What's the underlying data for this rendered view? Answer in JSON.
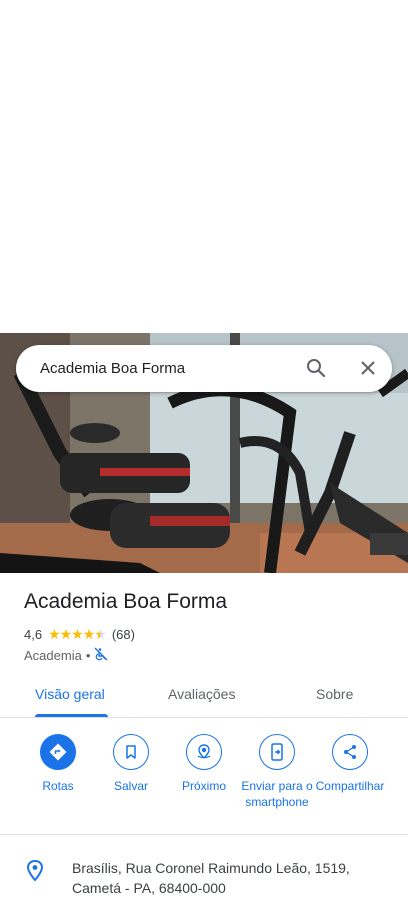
{
  "search": {
    "query": "Academia Boa Forma"
  },
  "place": {
    "name": "Academia Boa Forma",
    "rating": "4,6",
    "stars": "★★★★",
    "half_star": "★",
    "review_count": "(68)",
    "category": "Academia",
    "separator": "•"
  },
  "tabs": [
    {
      "label": "Visão geral"
    },
    {
      "label": "Avaliações"
    },
    {
      "label": "Sobre"
    }
  ],
  "actions": [
    {
      "label": "Rotas",
      "icon": "directions-icon"
    },
    {
      "label": "Salvar",
      "icon": "bookmark-icon"
    },
    {
      "label": "Próximo",
      "icon": "nearby-icon"
    },
    {
      "label": "Enviar para o smartphone",
      "icon": "send-to-phone-icon"
    },
    {
      "label": "Compartilhar",
      "icon": "share-icon"
    }
  ],
  "address": {
    "line1": "Brasílis, Rua Coronel Raimundo Leão, 1519,",
    "line2": "Cametá - PA, 68400-000"
  },
  "colors": {
    "accent": "#1a73e8",
    "star": "#fbbc04"
  }
}
